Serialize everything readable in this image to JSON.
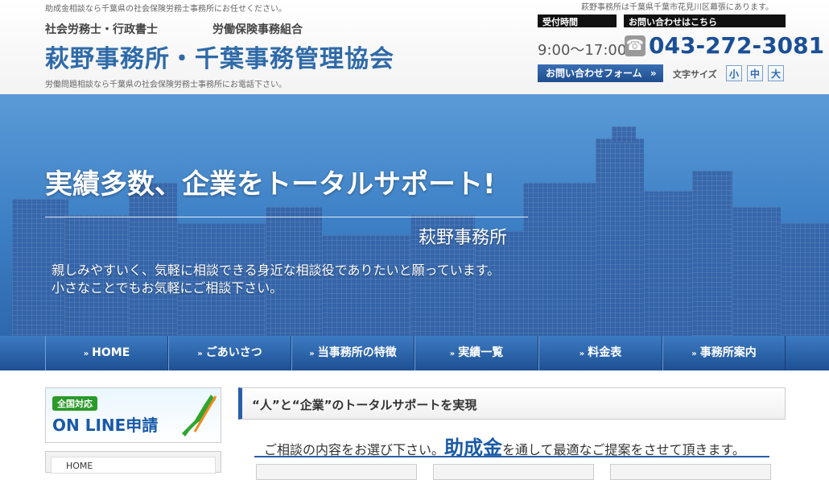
{
  "header": {
    "tagline_top": "助成金相談なら千葉県の社会保険労務士事務所にお任せください。",
    "address_note": "萩野事務所は千葉県千葉市花見川区幕張にあります。",
    "category_left": "社会労務士・行政書士",
    "category_right": "労働保険事務組合",
    "brand": "萩野事務所・千葉事務管理協会",
    "tagline_bottom": "労働問題相談なら千葉県の社会保険労務士事務所にお電話下さい。",
    "hours_label": "受付時間",
    "hours": "9:00〜17:00",
    "contact_label": "お問い合わせはこちら",
    "phone": "043-272-3081",
    "form_button": "お問い合わせフォーム",
    "font_size_label": "文字サイズ",
    "font_sizes": [
      "小",
      "中",
      "大"
    ]
  },
  "hero": {
    "title": "実績多数、企業をトータルサポート!",
    "office": "萩野事務所",
    "message_1": "親しみやすいく、気軽に相談できる身近な相談役でありたいと願っています。",
    "message_2": "小さなことでもお気軽にご相談下さい。"
  },
  "nav": {
    "items": [
      {
        "label": "HOME"
      },
      {
        "label": "ごあいさつ"
      },
      {
        "label": "当事務所の特徴"
      },
      {
        "label": "実績一覧"
      },
      {
        "label": "料金表"
      },
      {
        "label": "事務所案内"
      }
    ]
  },
  "sidebar": {
    "online_badge": "全国対応",
    "online_text": "ON LINE申請",
    "home_link": "HOME"
  },
  "main": {
    "heading": "“人”と“企業”のトータルサポートを実現",
    "select_prefix": "ご相談の内容をお選び下さい。",
    "select_highlight": "助成金",
    "select_suffix": "を通して最適なご提案をさせて頂きます。"
  },
  "colors": {
    "brand_blue": "#2f6aa8",
    "nav_blue": "#1e4f93"
  }
}
